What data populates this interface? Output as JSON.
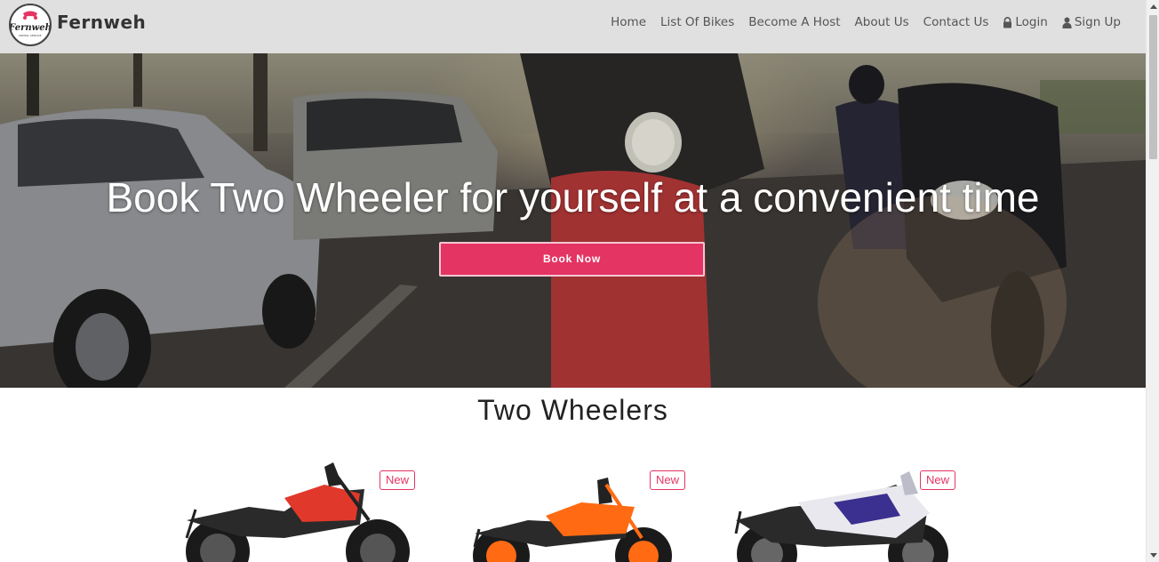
{
  "brand": {
    "name": "Fernweh",
    "logo_text": "Fernweh",
    "logo_subtext": "RENTAL SERVICE"
  },
  "nav": {
    "items": [
      {
        "label": "Home"
      },
      {
        "label": "List Of Bikes"
      },
      {
        "label": "Become A Host"
      },
      {
        "label": "About Us"
      },
      {
        "label": "Contact Us"
      },
      {
        "label": "Login",
        "icon": "lock-icon"
      },
      {
        "label": "Sign Up",
        "icon": "user-icon"
      }
    ]
  },
  "hero": {
    "title": "Book Two Wheeler for yourself at a convenient time",
    "button_label": "Book Now"
  },
  "section": {
    "title": "Two Wheelers",
    "cards": [
      {
        "badge": "New",
        "color": "#e0392b"
      },
      {
        "badge": "New",
        "color": "#ff6a13"
      },
      {
        "badge": "New",
        "color": "#3b2f8f"
      }
    ]
  },
  "colors": {
    "accent": "#e43463",
    "navbar_bg": "#e0e0e0"
  }
}
